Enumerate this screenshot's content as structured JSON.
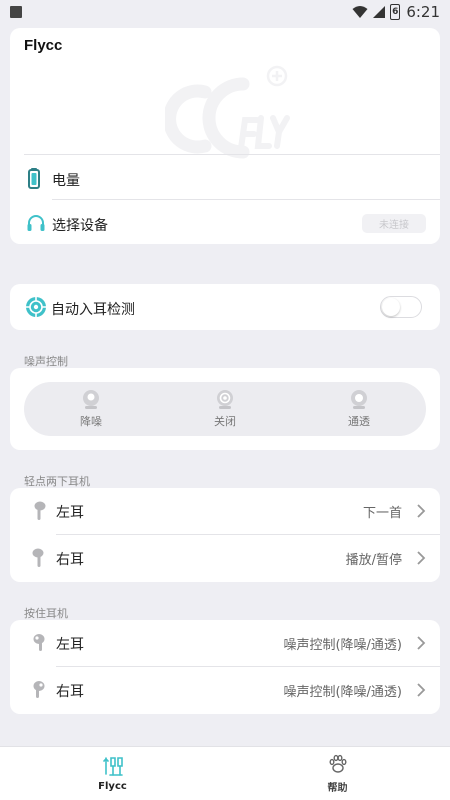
{
  "status_bar": {
    "time": "6:21",
    "battery_level": "6"
  },
  "device": {
    "name": "Flycc"
  },
  "battery_row": {
    "label": "电量"
  },
  "device_row": {
    "label": "选择设备",
    "status_badge": "未连接"
  },
  "auto_ear": {
    "label": "自动入耳检测",
    "enabled": false
  },
  "noise_control": {
    "section_title": "噪声控制",
    "options": [
      {
        "label": "降噪"
      },
      {
        "label": "关闭"
      },
      {
        "label": "通透"
      }
    ]
  },
  "double_tap": {
    "section_title": "轻点两下耳机",
    "rows": [
      {
        "label": "左耳",
        "value": "下一首"
      },
      {
        "label": "右耳",
        "value": "播放/暂停"
      }
    ]
  },
  "press_hold": {
    "section_title": "按住耳机",
    "rows": [
      {
        "label": "左耳",
        "value": "噪声控制(降噪/通透)"
      },
      {
        "label": "右耳",
        "value": "噪声控制(降噪/通透)"
      }
    ]
  },
  "tabs": [
    {
      "label": "Flycc",
      "active": true
    },
    {
      "label": "帮助",
      "active": false
    }
  ],
  "colors": {
    "accent_teal": "#3fc1c9",
    "icon_gray": "#b5b5b8",
    "background": "#eeeef3"
  }
}
